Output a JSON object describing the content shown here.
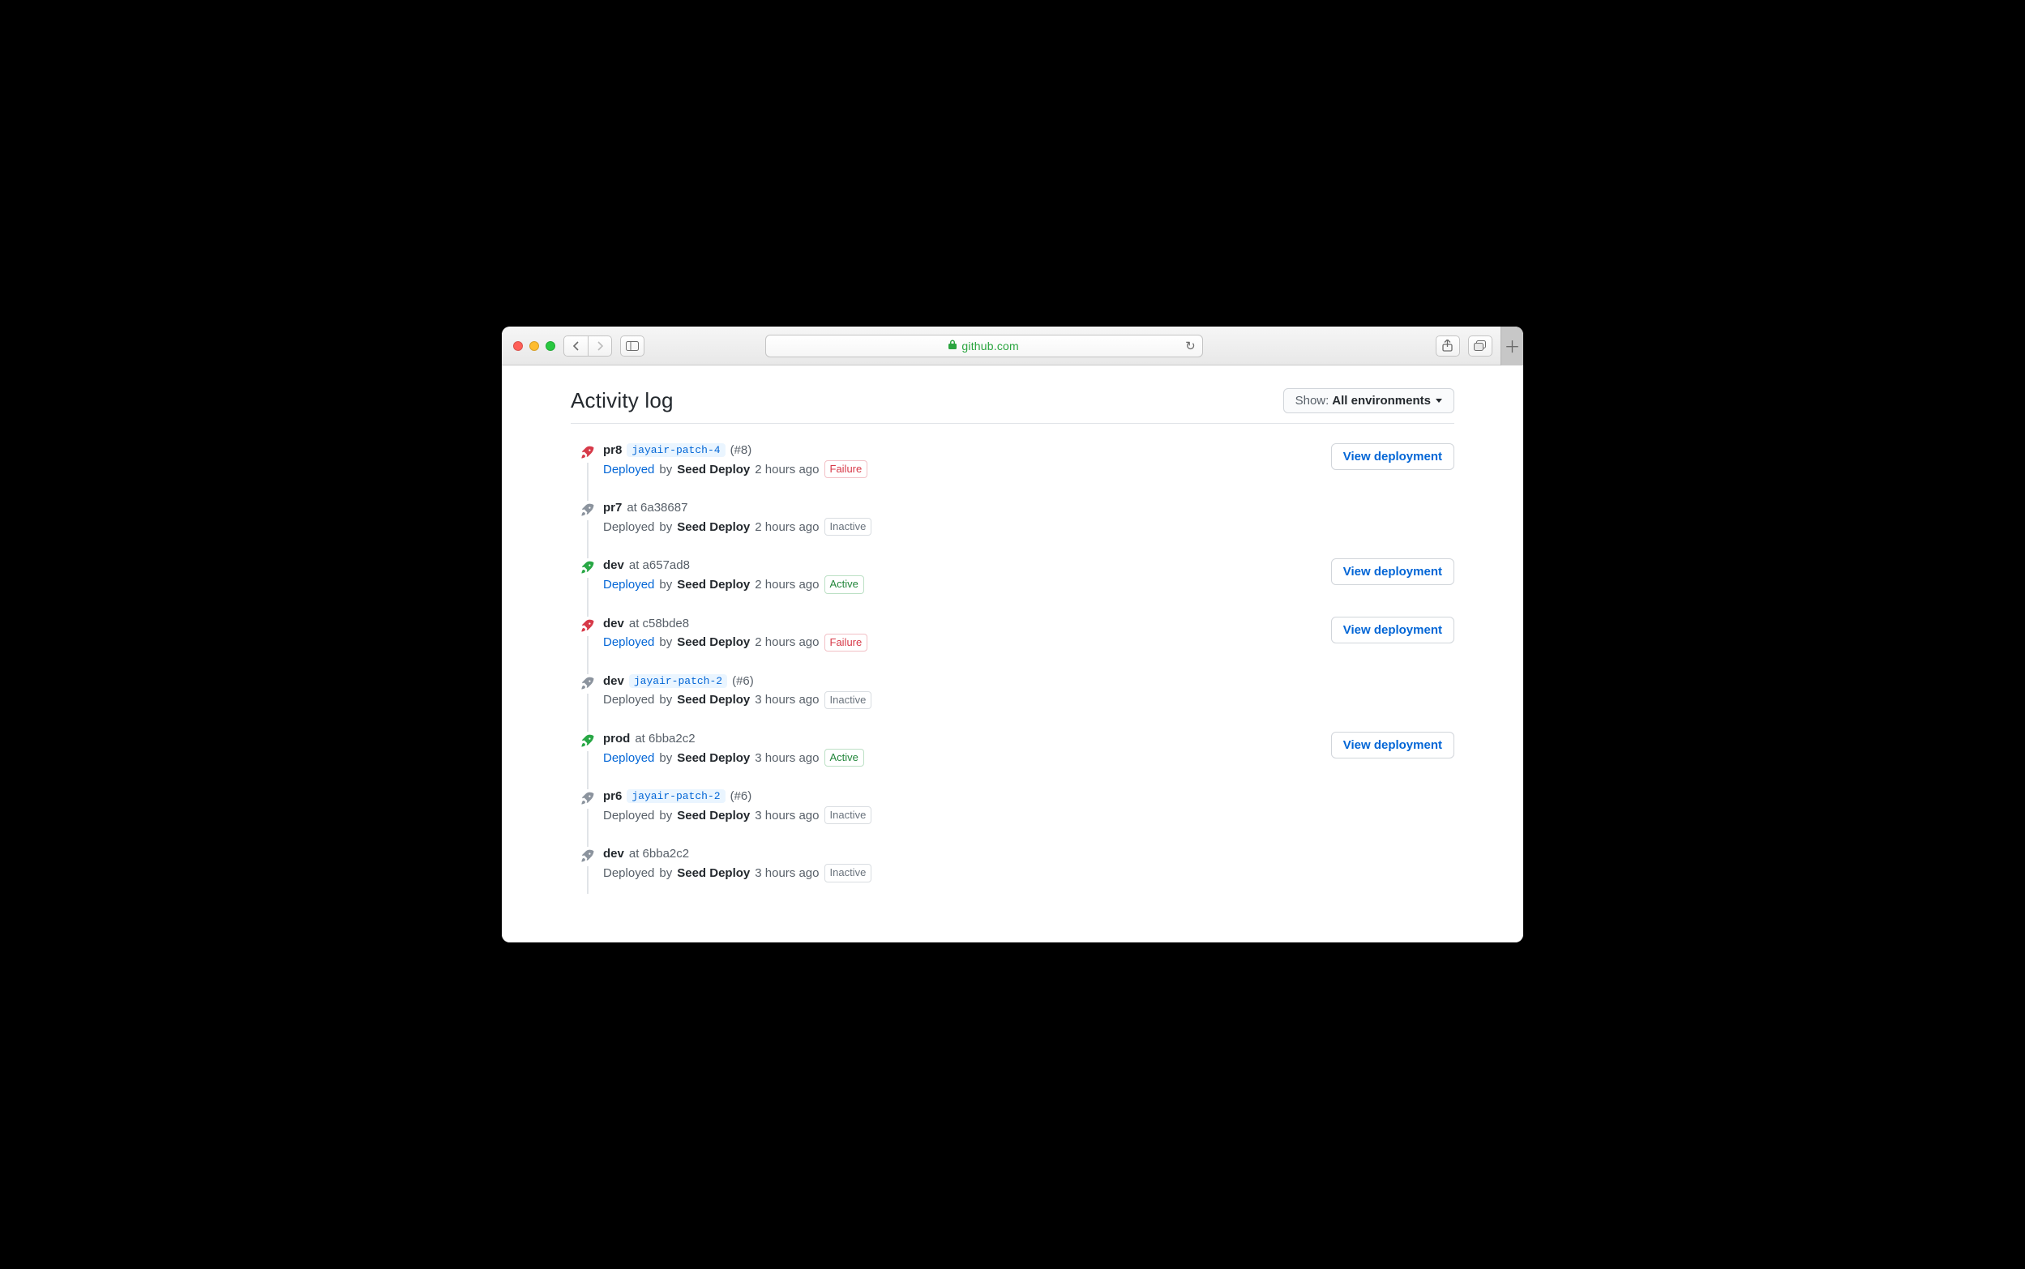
{
  "browser": {
    "domain": "github.com"
  },
  "header": {
    "title": "Activity log",
    "filter_prefix": "Show:",
    "filter_value": "All environments"
  },
  "labels": {
    "deployed": "Deployed",
    "by": "by",
    "at": "at",
    "view_deployment": "View deployment"
  },
  "statuses": {
    "failure": "Failure",
    "inactive": "Inactive",
    "active": "Active"
  },
  "items": [
    {
      "env": "pr8",
      "ref_kind": "branch",
      "ref": "jayair-patch-4",
      "pr": "#8",
      "deployed_link": true,
      "actor": "Seed Deploy",
      "time": "2 hours ago",
      "status": "failure",
      "rocket": "red",
      "view": true
    },
    {
      "env": "pr7",
      "ref_kind": "commit",
      "ref": "6a38687",
      "deployed_link": false,
      "actor": "Seed Deploy",
      "time": "2 hours ago",
      "status": "inactive",
      "rocket": "gray",
      "view": false
    },
    {
      "env": "dev",
      "ref_kind": "commit",
      "ref": "a657ad8",
      "deployed_link": true,
      "actor": "Seed Deploy",
      "time": "2 hours ago",
      "status": "active",
      "rocket": "green",
      "view": true
    },
    {
      "env": "dev",
      "ref_kind": "commit",
      "ref": "c58bde8",
      "deployed_link": true,
      "actor": "Seed Deploy",
      "time": "2 hours ago",
      "status": "failure",
      "rocket": "red",
      "view": true
    },
    {
      "env": "dev",
      "ref_kind": "branch",
      "ref": "jayair-patch-2",
      "pr": "#6",
      "deployed_link": false,
      "actor": "Seed Deploy",
      "time": "3 hours ago",
      "status": "inactive",
      "rocket": "gray",
      "view": false
    },
    {
      "env": "prod",
      "ref_kind": "commit",
      "ref": "6bba2c2",
      "deployed_link": true,
      "actor": "Seed Deploy",
      "time": "3 hours ago",
      "status": "active",
      "rocket": "green",
      "view": true
    },
    {
      "env": "pr6",
      "ref_kind": "branch",
      "ref": "jayair-patch-2",
      "pr": "#6",
      "deployed_link": false,
      "actor": "Seed Deploy",
      "time": "3 hours ago",
      "status": "inactive",
      "rocket": "gray",
      "view": false
    },
    {
      "env": "dev",
      "ref_kind": "commit",
      "ref": "6bba2c2",
      "deployed_link": false,
      "actor": "Seed Deploy",
      "time": "3 hours ago",
      "status": "inactive",
      "rocket": "gray",
      "view": false
    }
  ]
}
